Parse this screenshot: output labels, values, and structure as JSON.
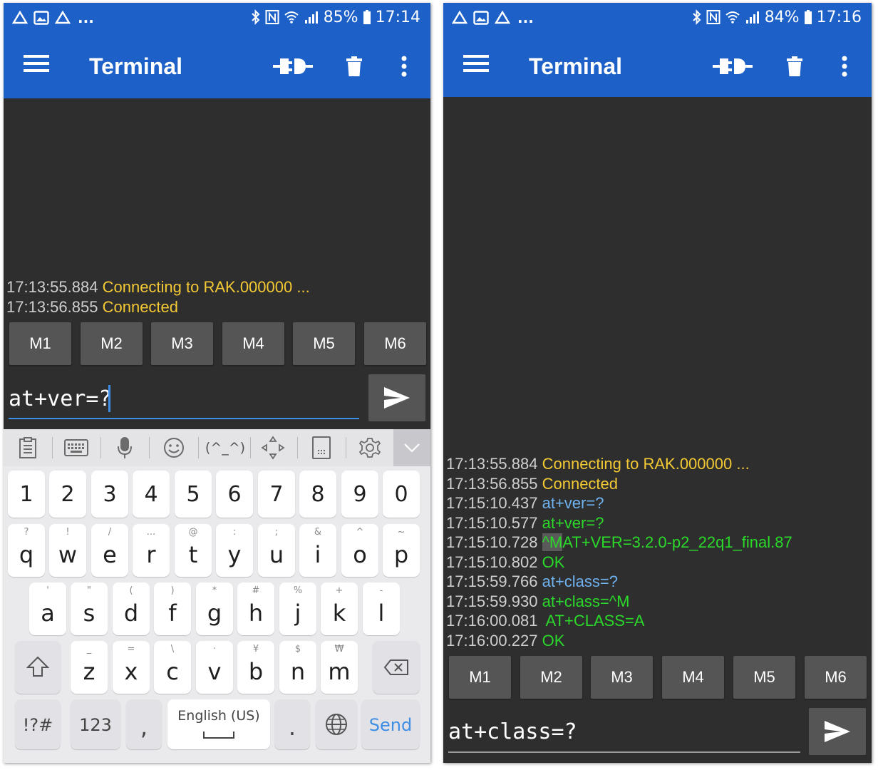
{
  "screens": [
    {
      "status": {
        "dots": "...",
        "battery": "85%",
        "time": "17:14"
      },
      "appbar": {
        "title": "Terminal"
      },
      "log": [
        {
          "ts": "17:13:55.884",
          "msg": "Connecting to RAK.000000 ...",
          "color": "yellow"
        },
        {
          "ts": "17:13:56.855",
          "msg": "Connected",
          "color": "yellow"
        }
      ],
      "macros": [
        "M1",
        "M2",
        "M3",
        "M4",
        "M5",
        "M6"
      ],
      "input": {
        "value": "at+ver=?"
      }
    },
    {
      "status": {
        "dots": "...",
        "battery": "84%",
        "time": "17:16"
      },
      "appbar": {
        "title": "Terminal"
      },
      "log": [
        {
          "ts": "17:13:55.884",
          "msg": "Connecting to RAK.000000 ...",
          "color": "yellow"
        },
        {
          "ts": "17:13:56.855",
          "msg": "Connected",
          "color": "yellow"
        },
        {
          "ts": "17:15:10.437",
          "msg": "at+ver=?",
          "color": "blue"
        },
        {
          "ts": "17:15:10.577",
          "msg": "at+ver=?",
          "color": "green"
        },
        {
          "ts": "17:15:10.728",
          "hl": "^M",
          "msg": "AT+VER=3.2.0-p2_22q1_final.87",
          "color": "green"
        },
        {
          "ts": "17:15:10.802",
          "msg": "OK",
          "color": "green"
        },
        {
          "ts": "17:15:59.766",
          "msg": "at+class=?",
          "color": "blue"
        },
        {
          "ts": "17:15:59.930",
          "msg": "at+class=^M",
          "color": "green"
        },
        {
          "ts": "17:16:00.081",
          "msg": " AT+CLASS=A",
          "color": "green"
        },
        {
          "ts": "17:16:00.227",
          "msg": "OK",
          "color": "green"
        }
      ],
      "macros": [
        "M1",
        "M2",
        "M3",
        "M4",
        "M5",
        "M6"
      ],
      "input": {
        "value": "at+class=?"
      }
    }
  ],
  "keyboard": {
    "toolbar_icons": [
      "clipboard-icon",
      "keyboard-icon",
      "microphone-icon",
      "emoji-icon",
      "kaomoji",
      "cursor-move-icon",
      "one-hand-icon",
      "settings-icon",
      "chevron-down-icon"
    ],
    "kaomoji": "(^_^)",
    "row_numbers": [
      "1",
      "2",
      "3",
      "4",
      "5",
      "6",
      "7",
      "8",
      "9",
      "0"
    ],
    "row_q": [
      {
        "k": "q",
        "s": "?"
      },
      {
        "k": "w",
        "s": "!"
      },
      {
        "k": "e",
        "s": "/"
      },
      {
        "k": "r",
        "s": "..."
      },
      {
        "k": "t",
        "s": "@"
      },
      {
        "k": "y",
        "s": ":"
      },
      {
        "k": "u",
        "s": ";"
      },
      {
        "k": "i",
        "s": "&"
      },
      {
        "k": "o",
        "s": "^"
      },
      {
        "k": "p",
        "s": "~"
      }
    ],
    "row_a": [
      {
        "k": "a",
        "s": "'"
      },
      {
        "k": "s",
        "s": "\""
      },
      {
        "k": "d",
        "s": "("
      },
      {
        "k": "f",
        "s": ")"
      },
      {
        "k": "g",
        "s": "*"
      },
      {
        "k": "h",
        "s": "#"
      },
      {
        "k": "j",
        "s": "%"
      },
      {
        "k": "k",
        "s": "+"
      },
      {
        "k": "l",
        "s": "-"
      }
    ],
    "row_z": [
      {
        "k": "z",
        "s": "_"
      },
      {
        "k": "x",
        "s": "="
      },
      {
        "k": "c",
        "s": "\\"
      },
      {
        "k": "v",
        "s": "·"
      },
      {
        "k": "b",
        "s": "¥"
      },
      {
        "k": "n",
        "s": "$"
      },
      {
        "k": "m",
        "s": "₩"
      }
    ],
    "symbols_label": "!?#",
    "numbers_label": "123",
    "comma": ",",
    "space_label": "English (US)",
    "period": ".",
    "send_label": "Send"
  },
  "colors": {
    "appbar": "#1d61c8",
    "terminal_bg": "#2e2e2e",
    "yellow": "#f3c934",
    "blue": "#6fb2f0",
    "green": "#2ad92a",
    "accent": "#3d8ee6"
  }
}
